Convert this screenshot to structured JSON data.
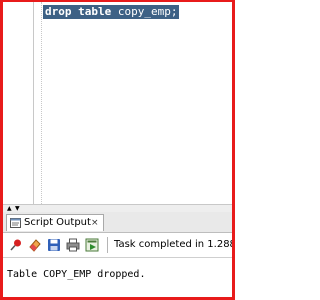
{
  "editor": {
    "keyword_drop": "drop",
    "keyword_table": "table",
    "table_name": "copy_emp;"
  },
  "output_panel": {
    "tab_label": "Script Output",
    "close_glyph": "×",
    "status_text": "Task completed in 1.288",
    "result_text": "Table COPY_EMP dropped.",
    "icons": [
      "pin-icon",
      "eraser-icon",
      "save-icon",
      "print-icon",
      "export-icon"
    ]
  },
  "colors": {
    "frame_border": "#e81b1b",
    "selection": "#3d6185"
  }
}
